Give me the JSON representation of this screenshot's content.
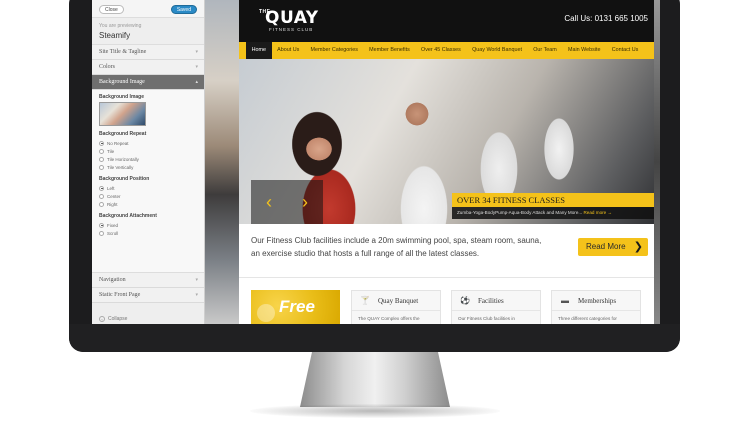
{
  "customizer": {
    "close_label": "Close",
    "saved_label": "Saved",
    "previewing_label": "You are previewing",
    "theme_name": "Steamify",
    "sections": {
      "site_title": "Site Title & Tagline",
      "colors": "Colors",
      "background_image": "Background Image",
      "navigation": "Navigation",
      "static_front_page": "Static Front Page"
    },
    "background_image_label": "Background Image",
    "repeat": {
      "heading": "Background Repeat",
      "options": [
        "No Repeat",
        "Tile",
        "Tile Horizontally",
        "Tile Vertically"
      ],
      "selected": "No Repeat"
    },
    "position": {
      "heading": "Background Position",
      "options": [
        "Left",
        "Center",
        "Right"
      ],
      "selected": "Left"
    },
    "attachment": {
      "heading": "Background Attachment",
      "options": [
        "Fixed",
        "Scroll"
      ],
      "selected": "Fixed"
    },
    "collapse_label": "Collapse"
  },
  "site": {
    "logo": {
      "the": "THE",
      "quay": "QUAY",
      "tagline": "FITNESS CLUB"
    },
    "call": "Call Us: 0131 665 1005",
    "nav": [
      "Home",
      "About Us",
      "Member Categories",
      "Member Benefits",
      "Over 45 Classes",
      "Quay World Banquet",
      "Our Team",
      "Main Website",
      "Contact Us"
    ],
    "slider": {
      "prev_icon": "‹",
      "next_icon": "›",
      "caption_title": "OVER 34 FITNESS CLASSES",
      "caption_text": "Zumba-Yoga-BodyPump-Aqua-Body Attack and Many More...",
      "caption_link": "Read more →"
    },
    "intro_text": "Our Fitness Club facilities include a 20m swimming pool, spa, steam room, sauna, an exercise studio that hosts a full range of all the latest classes.",
    "read_more": "Read More",
    "promo_text": "Free",
    "cards": [
      {
        "title": "Quay Banquet",
        "icon": "🍸",
        "text": "The QUAY Complex offers the"
      },
      {
        "title": "Facilities",
        "icon": "⚽",
        "text": "Our Fitness Club facilities in"
      },
      {
        "title": "Memberships",
        "icon": "▬",
        "text": "Three different categories for"
      }
    ]
  }
}
